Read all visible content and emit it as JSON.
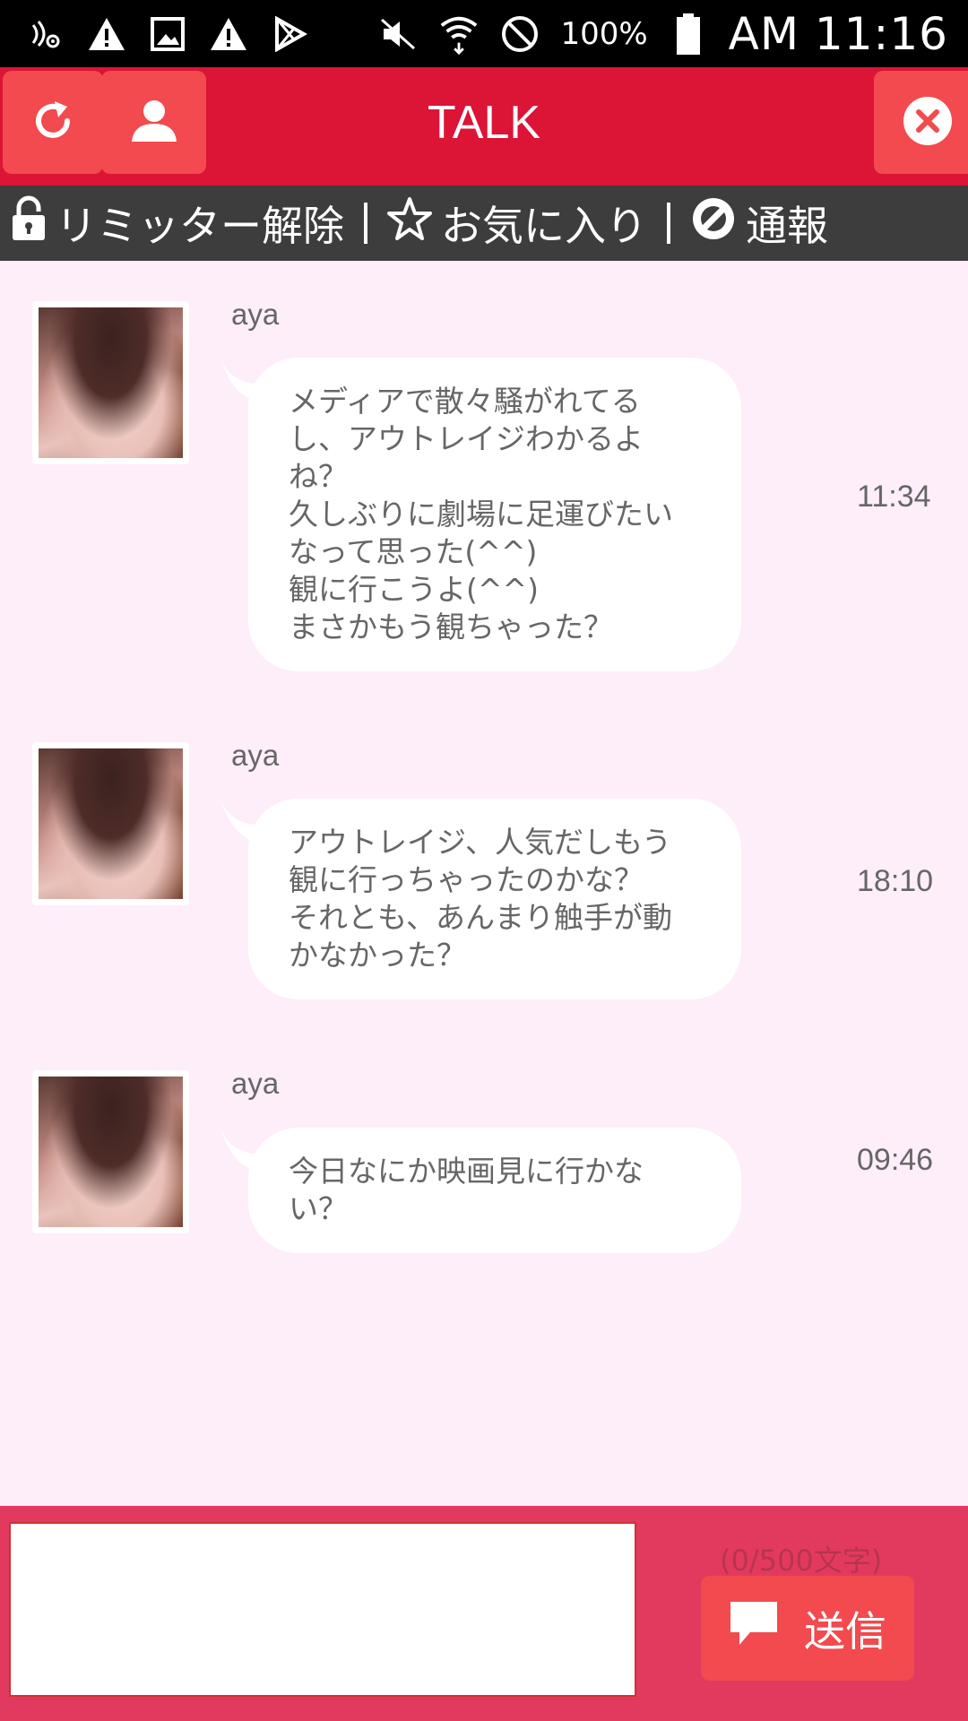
{
  "status_bar": {
    "battery_text": "100%",
    "clock": "AM 11:16",
    "icons": [
      "signal-settings-icon",
      "warning-icon",
      "image-icon",
      "warning-icon",
      "play-store-icon",
      "mute-icon",
      "wifi-icon",
      "blocked-icon",
      "battery-icon"
    ]
  },
  "header": {
    "title": "TALK",
    "reload_icon": "reload-icon",
    "profile_icon": "user-icon",
    "close_icon": "close-icon"
  },
  "actions": {
    "unlock_label": "リミッター解除",
    "favorite_label": "お気に入り",
    "report_label": "通報"
  },
  "messages": [
    {
      "sender": "aya",
      "text": "メディアで散々騒がれてる\nし、アウトレイジわかるよ\nね？\n久しぶりに劇場に足運びたい\nなって思った(^^)\n観に行こうよ(^^)\nまさかもう観ちゃった？",
      "time": "11:34"
    },
    {
      "sender": "aya",
      "text": "アウトレイジ、人気だしもう\n観に行っちゃったのかな？\nそれとも、あんまり触手が動\nかなかった？",
      "time": "18:10"
    },
    {
      "sender": "aya",
      "text": "今日なにか映画見に行かな\nい？",
      "time": "09:46"
    }
  ],
  "composer": {
    "input_value": "",
    "counter": "(0/500文字)",
    "send_label": "送信"
  },
  "colors": {
    "header_red": "#dc1436",
    "button_red": "#f24a4e",
    "action_bar": "#3d3d3d",
    "background_pink": "#fdeefa",
    "composer_pink": "#e23a5e"
  }
}
